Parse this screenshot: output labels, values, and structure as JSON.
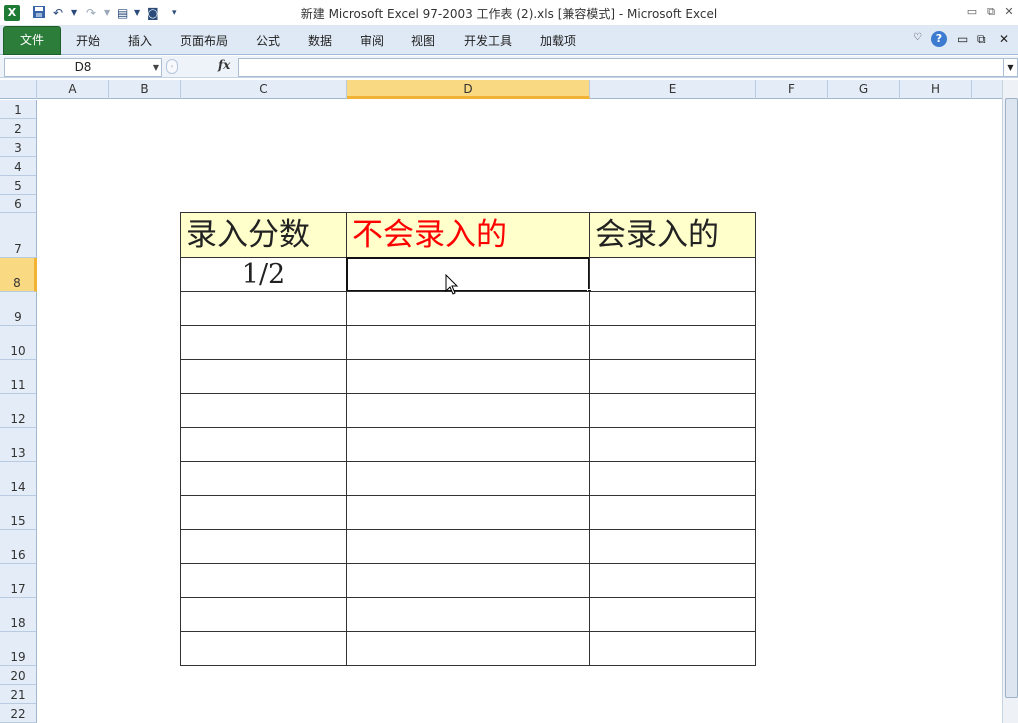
{
  "window": {
    "title": "新建 Microsoft Excel 97-2003 工作表 (2).xls  [兼容模式]  -  Microsoft Excel"
  },
  "ribbon": {
    "file_tab": "文件",
    "tabs": [
      "开始",
      "插入",
      "页面布局",
      "公式",
      "数据",
      "审阅",
      "视图",
      "开发工具",
      "加载项"
    ]
  },
  "formula_bar": {
    "name_box": "D8",
    "fx_label": "fx",
    "formula": ""
  },
  "grid": {
    "columns": [
      "A",
      "B",
      "C",
      "D",
      "E",
      "F",
      "G",
      "H"
    ],
    "selected_column": "D",
    "rows": [
      "1",
      "2",
      "3",
      "4",
      "5",
      "6",
      "7",
      "8",
      "9",
      "10",
      "11",
      "12",
      "13",
      "14",
      "15",
      "16",
      "17",
      "18",
      "19",
      "20",
      "21",
      "22"
    ],
    "selected_row": "8",
    "header_row": {
      "c7": "录入分数",
      "d7": "不会录入的",
      "e7": "会录入的"
    },
    "c8": "1/2",
    "d8": "",
    "e8": ""
  },
  "colors": {
    "header_fill": "#ffffcc",
    "red_text": "#ff0000",
    "file_tab_green": "#2d7d3a",
    "selected_header": "#f9d981"
  },
  "icons": [
    "excel-app-icon",
    "save-icon",
    "undo-icon",
    "redo-icon",
    "print-preview-icon",
    "camera-icon",
    "customize-toolbar-icon",
    "minimize-icon",
    "restore-icon",
    "close-icon",
    "help-icon",
    "ribbon-minimize-icon",
    "mouse-pointer-icon"
  ]
}
